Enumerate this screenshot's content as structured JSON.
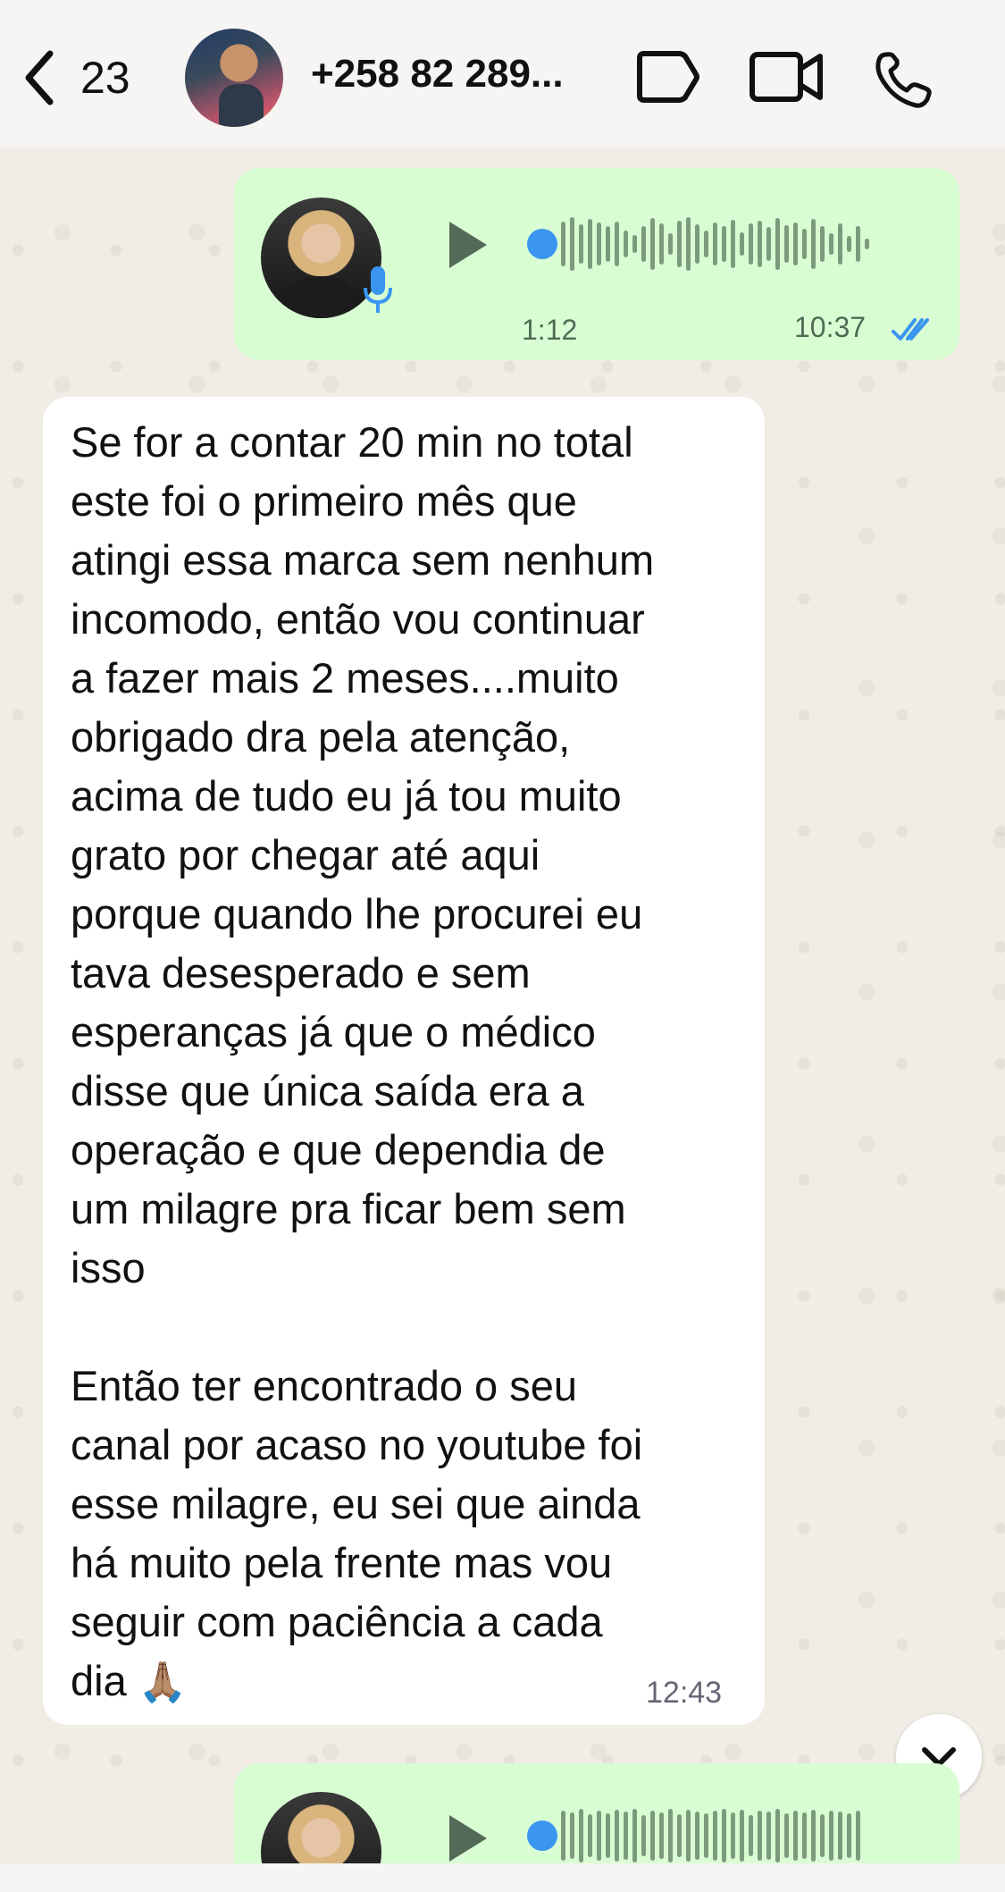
{
  "header": {
    "back_count": "23",
    "contact_name": "+258 82 289...",
    "icons": [
      "back-chevron-icon",
      "tag-icon",
      "video-call-icon",
      "phone-icon"
    ]
  },
  "messages": [
    {
      "type": "voice",
      "direction": "outgoing",
      "duration": "1:12",
      "time": "10:37",
      "status": "read"
    },
    {
      "type": "text",
      "direction": "incoming",
      "text": "Se for a contar 20 min no total\neste foi o primeiro mês que\natingi essa marca sem nenhum\nincomodo, então vou continuar\na fazer mais 2 meses....muito\nobrigado dra pela atenção,\nacima de tudo eu já tou muito\ngrato por chegar até aqui\nporque quando lhe procurei eu\ntava desesperado e sem\nesperanças já que o médico\ndisse que única saída era a\noperação e que dependia de\num milagre pra ficar bem sem\nisso\n\nEntão ter encontrado o seu\ncanal por acaso no youtube foi\nesse milagre, eu sei que ainda\nhá muito pela frente mas vou\nseguir com paciência a cada\ndia",
      "emoji": "🙏🏽",
      "time": "12:43"
    },
    {
      "type": "voice",
      "direction": "outgoing"
    }
  ],
  "colors": {
    "outgoing_bubble": "#d9fdd3",
    "incoming_bubble": "#ffffff",
    "read_ticks": "#3a96f0",
    "background": "#efeae2"
  }
}
